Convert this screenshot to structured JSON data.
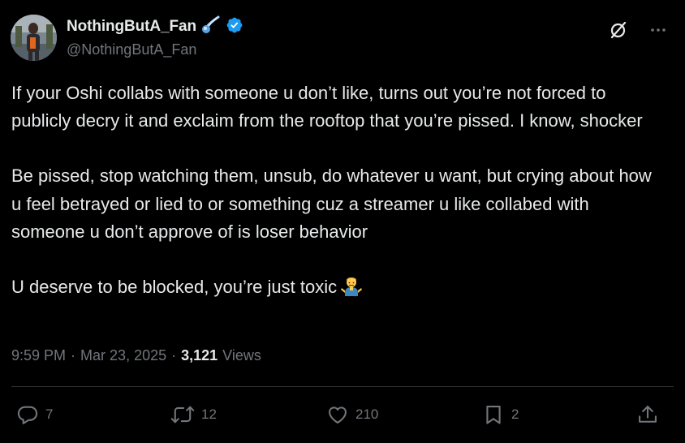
{
  "author": {
    "display_name": "NothingButA_Fan",
    "handle": "@NothingButA_Fan",
    "verified": true
  },
  "tweet": {
    "paragraphs": [
      "If your Oshi collabs with someone u don’t like, turns out you’re not forced to publicly decry it and exclaim from the rooftop that you’re pissed. I know, shocker",
      "Be pissed, stop watching them, unsub, do whatever u want, but crying about how u feel betrayed or lied to or something cuz a streamer u like collabed with someone u don’t approve of is loser behavior",
      "U deserve to be blocked, you’re just toxic"
    ],
    "trailing_emoji": "man-shrugging-icon"
  },
  "meta": {
    "time": "9:59 PM",
    "separator": "·",
    "date": "Mar 23, 2025",
    "views_count": "3,121",
    "views_label": "Views"
  },
  "actions": {
    "replies": "7",
    "reposts": "12",
    "likes": "210",
    "bookmarks": "2"
  },
  "colors": {
    "background": "#000000",
    "text": "#e7e9ea",
    "secondary": "#71767b",
    "verified": "#1d9bf0",
    "divider": "#2f3336"
  }
}
